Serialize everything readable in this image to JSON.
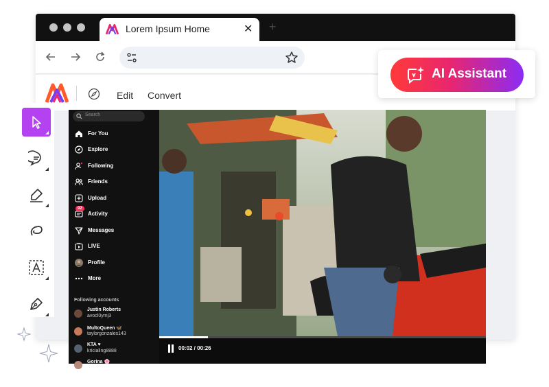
{
  "browser": {
    "tab_title": "Lorem Ipsum Home",
    "tab_close": "✕",
    "new_tab": "+",
    "address_value": ""
  },
  "app_menu": {
    "edit": "Edit",
    "convert": "Convert"
  },
  "ai_assistant": {
    "label": "AI Assistant",
    "gradient": [
      "#ff3a3a",
      "#e8266e",
      "#8b2cf5"
    ]
  },
  "tools": [
    {
      "name": "select-tool",
      "icon": "cursor-icon",
      "active": true
    },
    {
      "name": "comment-tool",
      "icon": "speech-bubble-icon",
      "active": false
    },
    {
      "name": "highlight-tool",
      "icon": "highlighter-icon",
      "active": false
    },
    {
      "name": "draw-tool",
      "icon": "freehand-icon",
      "active": false
    },
    {
      "name": "text-tool",
      "icon": "text-box-icon",
      "active": false
    },
    {
      "name": "sign-tool",
      "icon": "pen-nib-icon",
      "active": false
    }
  ],
  "social": {
    "search_placeholder": "Search",
    "nav": [
      {
        "label": "For You",
        "icon": "home-icon"
      },
      {
        "label": "Explore",
        "icon": "compass-icon"
      },
      {
        "label": "Following",
        "icon": "following-icon"
      },
      {
        "label": "Friends",
        "icon": "friends-icon"
      },
      {
        "label": "Upload",
        "icon": "upload-icon"
      },
      {
        "label": "Activity",
        "icon": "activity-icon",
        "badge": "92"
      },
      {
        "label": "Messages",
        "icon": "messages-icon"
      },
      {
        "label": "LIVE",
        "icon": "live-icon"
      },
      {
        "label": "Profile",
        "icon": "profile-icon"
      },
      {
        "label": "More",
        "icon": "more-icon"
      }
    ],
    "following_title": "Following accounts",
    "accounts": [
      {
        "name": "Justin Roberts",
        "handle": "avocl0ymj3"
      },
      {
        "name": "MultoQueen 🦋",
        "handle": "taylorgonzales143"
      },
      {
        "name": "KTA ♥",
        "handle": "kricialing8888"
      },
      {
        "name": "Gorina 🌸",
        "handle": ""
      }
    ]
  },
  "player": {
    "time": "00:02 / 00:26",
    "progress": 0.15
  }
}
